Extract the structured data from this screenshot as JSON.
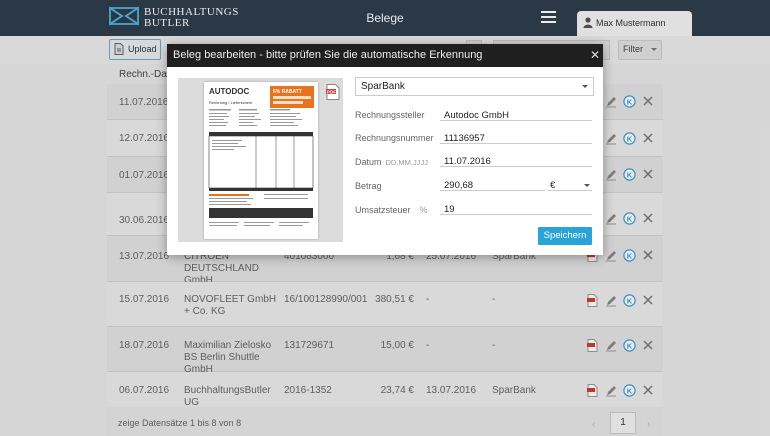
{
  "header": {
    "logo_line1": "BUCHHALTUNGS",
    "logo_line2": "BUTLER",
    "title": "Belege",
    "user": "Max Mustermann"
  },
  "toolbar": {
    "upload_label": "Upload",
    "filter_label": "Filter"
  },
  "table": {
    "column_header": "Rechn.-Dat.",
    "rows": [
      {
        "date": "11.07.2016",
        "name": "",
        "number": "",
        "amount": "",
        "date2": "",
        "bank": ""
      },
      {
        "date": "12.07.2016",
        "name": "",
        "number": "",
        "amount": "",
        "date2": "",
        "bank": ""
      },
      {
        "date": "01.07.2016",
        "name": "",
        "number": "",
        "amount": "",
        "date2": "",
        "bank": ""
      },
      {
        "date": "30.06.2016",
        "name": "",
        "number": "",
        "amount": "",
        "date2": "",
        "bank": ""
      },
      {
        "date": "13.07.2016",
        "name": "CITROEN DEUTSCHLAND GmbH",
        "number": "401083000",
        "amount": "1,68 €",
        "date2": "25.07.2016",
        "bank": "SparBank"
      },
      {
        "date": "15.07.2016",
        "name": "NOVOFLEET GmbH + Co. KG",
        "number": "16/100128990/001",
        "amount": "380,51 €",
        "date2": "-",
        "bank": "-"
      },
      {
        "date": "18.07.2016",
        "name": "Maximilian Zielosko BS Berlin Shuttle GmbH",
        "number": "131729671",
        "amount": "15,00 €",
        "date2": "-",
        "bank": "-"
      },
      {
        "date": "06.07.2016",
        "name": "BuchhaltungsButler UG",
        "number": "2016-1352",
        "amount": "23,74 €",
        "date2": "13.07.2016",
        "bank": "SparBank"
      }
    ],
    "footer_info": "zeige Datensätze 1 bis 8 von 8",
    "current_page": "1"
  },
  "modal": {
    "title": "Beleg bearbeiten - bitte prüfen Sie die automatische Erkennung",
    "bank_selected": "SparBank",
    "fields": {
      "issuer_label": "Rechnungssteller",
      "issuer_value": "Autodoc GmbH",
      "number_label": "Rechnungsnummer",
      "number_value": "11136957",
      "date_label": "Datum",
      "date_hint": "DD.MM.JJJJ",
      "date_value": "11.07.2016",
      "amount_label": "Betrag",
      "amount_value": "290,68",
      "currency_value": "€",
      "vat_label": "Umsatzsteuer",
      "vat_hint": "%",
      "vat_value": "19"
    },
    "save_label": "Speichern",
    "preview": {
      "brand": "AUTODOC",
      "banner": "5% RABATT",
      "doc_title": "Rechnung / Lieferschein"
    }
  },
  "colors": {
    "header_bg": "#2f3d4c",
    "accent": "#2aa3d8",
    "logo": "#4fb9e0",
    "pdf_red": "#d23c30"
  }
}
